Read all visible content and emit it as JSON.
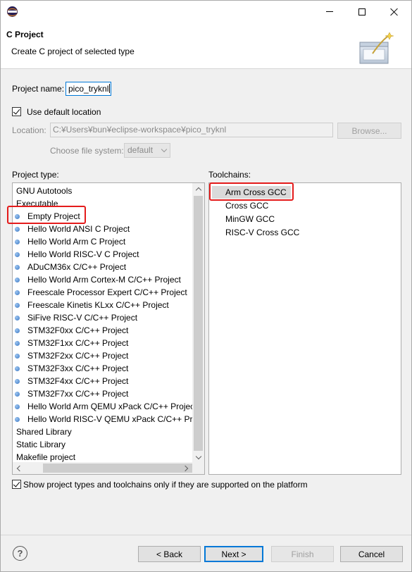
{
  "window": {
    "title": "",
    "icon": "eclipse-icon"
  },
  "header": {
    "title": "C Project",
    "description": "Create C project of selected type",
    "image": "new-project-wizard-icon"
  },
  "form": {
    "project_name_label": "Project name:",
    "project_name_value": "pico_tryknl",
    "use_default_location_label": "Use default location",
    "use_default_location_checked": true,
    "location_label": "Location:",
    "location_value": "C:¥Users¥bun¥eclipse-workspace¥pico_tryknl",
    "browse_label": "Browse...",
    "file_system_label": "Choose file system:",
    "file_system_value": "default"
  },
  "project_types": {
    "heading": "Project type:",
    "items": [
      {
        "label": "GNU Autotools",
        "child": false
      },
      {
        "label": "Executable",
        "child": false
      },
      {
        "label": "Empty Project",
        "child": true,
        "highlighted": true
      },
      {
        "label": "Hello World ANSI C Project",
        "child": true
      },
      {
        "label": "Hello World Arm C Project",
        "child": true
      },
      {
        "label": "Hello World RISC-V C Project",
        "child": true
      },
      {
        "label": "ADuCM36x C/C++ Project",
        "child": true
      },
      {
        "label": "Hello World Arm Cortex-M C/C++ Project",
        "child": true
      },
      {
        "label": "Freescale Processor Expert C/C++ Project",
        "child": true
      },
      {
        "label": "Freescale Kinetis KLxx C/C++ Project",
        "child": true
      },
      {
        "label": "SiFive RISC-V C/C++ Project",
        "child": true
      },
      {
        "label": "STM32F0xx C/C++ Project",
        "child": true
      },
      {
        "label": "STM32F1xx C/C++ Project",
        "child": true
      },
      {
        "label": "STM32F2xx C/C++ Project",
        "child": true
      },
      {
        "label": "STM32F3xx C/C++ Project",
        "child": true
      },
      {
        "label": "STM32F4xx C/C++ Project",
        "child": true
      },
      {
        "label": "STM32F7xx C/C++ Project",
        "child": true
      },
      {
        "label": "Hello World Arm QEMU xPack C/C++ Project",
        "child": true
      },
      {
        "label": "Hello World RISC-V QEMU xPack C/C++ Project",
        "child": true
      },
      {
        "label": "Shared Library",
        "child": false
      },
      {
        "label": "Static Library",
        "child": false
      },
      {
        "label": "Makefile project",
        "child": false
      }
    ]
  },
  "toolchains": {
    "heading": "Toolchains:",
    "items": [
      {
        "label": "Arm Cross GCC",
        "selected": true
      },
      {
        "label": "Cross GCC"
      },
      {
        "label": "MinGW GCC"
      },
      {
        "label": "RISC-V Cross GCC"
      }
    ]
  },
  "show_supported_label": "Show project types and toolchains only if they are supported on the platform",
  "show_supported_checked": true,
  "buttons": {
    "help": "?",
    "back": "< Back",
    "next": "Next >",
    "finish": "Finish",
    "cancel": "Cancel"
  },
  "colors": {
    "highlight_border": "#e41b1b",
    "focus_blue": "#0078d7",
    "selection_gray": "#dadada"
  }
}
